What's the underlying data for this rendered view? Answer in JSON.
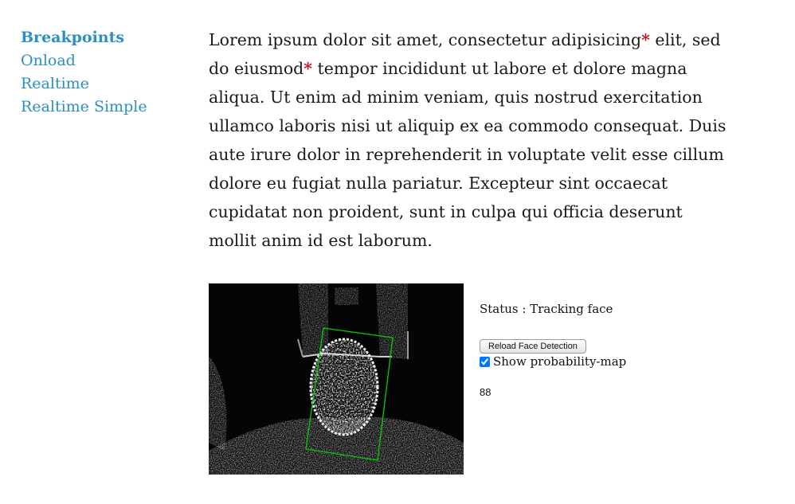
{
  "nav": {
    "items": [
      {
        "label": "Breakpoints",
        "active": true
      },
      {
        "label": "Onload",
        "active": false
      },
      {
        "label": "Realtime",
        "active": false
      },
      {
        "label": "Realtime Simple",
        "active": false
      }
    ]
  },
  "article": {
    "lines": [
      {
        "a": "Lorem ipsum dolor sit amet, consectetur adipisicing",
        "star": "*",
        "b": " elit, sed"
      },
      {
        "a": "do eiusmod",
        "star": "*",
        "b": " tempor incididunt ut labore et dolore magna"
      },
      {
        "a": "aliqua. Ut enim ad minim veniam, quis nostrud exercitation",
        "star": "",
        "b": ""
      },
      {
        "a": "ullamco laboris nisi ut aliquip ex ea commodo consequat. Duis",
        "star": "",
        "b": ""
      },
      {
        "a": "aute irure dolor in reprehenderit in voluptate velit esse cillum",
        "star": "",
        "b": ""
      },
      {
        "a": "dolore eu fugiat nulla pariatur. Excepteur sint occaecat",
        "star": "",
        "b": ""
      },
      {
        "a": "cupidatat non proident, sunt in culpa qui officia deserunt",
        "star": "",
        "b": ""
      },
      {
        "a": "mollit anim id est laborum.",
        "star": "",
        "b": ""
      }
    ]
  },
  "tracker": {
    "status_text": "Status : Tracking face",
    "reload_label": "Reload Face Detection",
    "checkbox_label": "Show probability-map",
    "checkbox_checked": true,
    "count": "88"
  },
  "colors": {
    "link": "#2a8fc4",
    "asterisk": "#c0161c",
    "tracking_box": "#00d000"
  }
}
